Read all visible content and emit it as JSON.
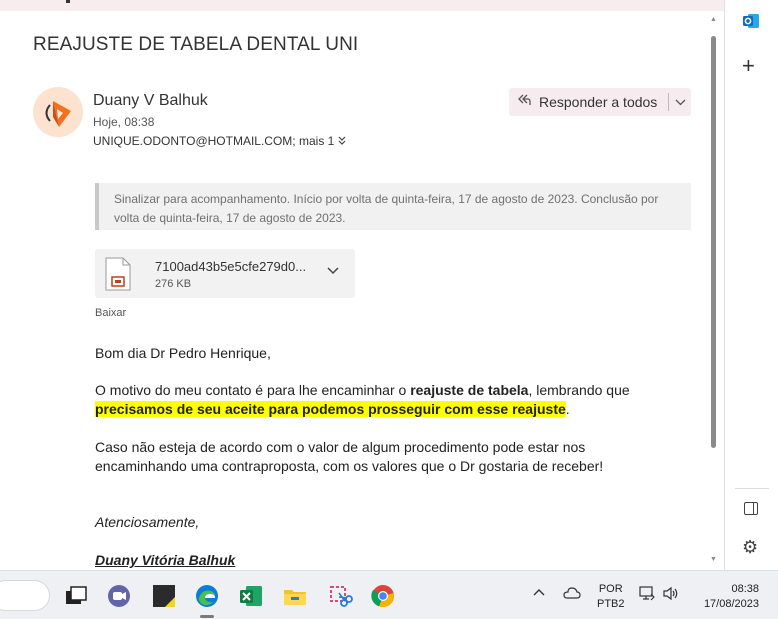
{
  "email": {
    "subject": "REAJUSTE DE TABELA DENTAL UNI",
    "sender_name": "Duany V Balhuk",
    "sent_time": "Hoje, 08:38",
    "recipients": "UNIQUE.ODONTO@HOTMAIL.COM;",
    "recipients_more": "mais 1",
    "reply_all_label": "Responder a todos",
    "flag_note": "Sinalizar para acompanhamento. Início por volta de quinta-feira, 17 de agosto de 2023. Conclusão por volta de quinta-feira, 17 de agosto de 2023.",
    "attachment": {
      "file_name": "7100ad43b5e5cfe279d0...",
      "file_size": "276 KB",
      "type_label": "pdf"
    },
    "download_label": "Baixar",
    "greeting": "Bom dia Dr Pedro Henrique,",
    "p1_part1": "O motivo do meu contato é para lhe encaminhar o ",
    "p1_bold": "reajuste de tabela",
    "p1_part2": ", lembrando que ",
    "p1_highlight": "precisamos de seu aceite para podemos prosseguir com esse reajuste",
    "p1_end": ".",
    "p2": "Caso não esteja de acordo com o valor de algum procedimento pode estar nos encaminhando uma contraproposta, com os valores que o Dr gostaria de receber!",
    "closing": "Atenciosamente,",
    "signature": "Duany Vitória Balhuk"
  },
  "taskbar": {
    "language_line1": "POR",
    "language_line2": "PTB2",
    "clock_time": "08:38",
    "clock_date": "17/08/2023"
  },
  "colors": {
    "highlight": "#ffff00",
    "reply_bg": "#f6ecef",
    "outlook_blue": "#0f6cbd",
    "avatar_bg": "#fde3cf"
  }
}
